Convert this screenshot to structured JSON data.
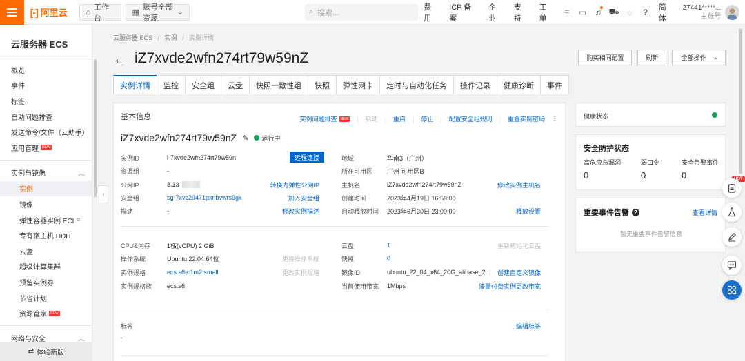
{
  "topbar": {
    "logo_text": "阿里云",
    "workbench": "工作台",
    "account_scope": "账号全部资源",
    "search_placeholder": "搜索...",
    "links": [
      "费用",
      "ICP 备案",
      "企业",
      "支持",
      "工单"
    ],
    "lang": "简体",
    "account_name": "27441*****...",
    "account_role": "主账号"
  },
  "sidebar": {
    "title": "云服务器 ECS",
    "top_items": [
      "概览",
      "事件",
      "标签",
      "自助问题排查",
      "发送命令/文件（云助手）",
      "应用管理"
    ],
    "group1": "实例与镜像",
    "group1_items": [
      "实例",
      "镜像",
      "弹性容器实例 ECI",
      "专有宿主机 DDH",
      "云盒",
      "超级计算集群",
      "预留实例券",
      "节省计划",
      "资源管家"
    ],
    "group2": "网络与安全",
    "footer": "体验新版",
    "new_badge": "NEW"
  },
  "main": {
    "breadcrumb": [
      "云服务器 ECS",
      "实例",
      "实例详情"
    ],
    "title": "iZ7xvde2wfn274rt79w59nZ",
    "actions": [
      "购买相同配置",
      "刷新",
      "全部操作"
    ],
    "tabs": [
      "实例详情",
      "监控",
      "安全组",
      "云盘",
      "快照一致性组",
      "快照",
      "弹性网卡",
      "定时与自动化任务",
      "操作记录",
      "健康诊断",
      "事件"
    ]
  },
  "basic": {
    "heading": "基本信息",
    "quick_actions": [
      "实例问题排查",
      "启动",
      "重启",
      "停止",
      "配置安全组规则",
      "重置实例密码"
    ],
    "instance_name": "iZ7xvde2wfn274rt79w59nZ",
    "status": "运行中",
    "connect_btn": "远程连接",
    "left": [
      {
        "label": "实例ID",
        "value": "i-7xvde2wfn274rt79w59n",
        "link": ""
      },
      {
        "label": "资源组",
        "value": "-",
        "link": ""
      },
      {
        "label": "公网IP",
        "value": "8.13",
        "link": "转换为弹性公网IP"
      },
      {
        "label": "安全组",
        "value": "sg-7xvc29471pxnbvwrs9gk",
        "link": "加入安全组"
      },
      {
        "label": "描述",
        "value": "-",
        "link": "修改实例描述"
      }
    ],
    "right": [
      {
        "label": "地域",
        "value": "华南3（广州）",
        "link": ""
      },
      {
        "label": "所在可用区",
        "value": "广州 可用区B",
        "link": ""
      },
      {
        "label": "主机名",
        "value": "iZ7xvde2wfn274rt79w59nZ",
        "link": "修改实例主机名"
      },
      {
        "label": "创建时间",
        "value": "2023年4月19日 16:59:00",
        "link": ""
      },
      {
        "label": "自动释放时间",
        "value": "2023年6月30日 23:00:00",
        "link": "释放设置"
      }
    ],
    "left2": [
      {
        "label": "CPU&内存",
        "value": "1核(vCPU) 2 GiB",
        "link": ""
      },
      {
        "label": "操作系统",
        "value": "Ubuntu 22.04 64位",
        "link": "更换操作系统"
      },
      {
        "label": "实例规格",
        "value": "ecs.s6-c1m2.small",
        "link": "更改实例规格"
      },
      {
        "label": "实例规格族",
        "value": "ecs.s6",
        "link": ""
      }
    ],
    "right2": [
      {
        "label": "云盘",
        "value": "1",
        "link": "重新初始化云盘"
      },
      {
        "label": "快照",
        "value": "0",
        "link": ""
      },
      {
        "label": "镜像ID",
        "value": "ubuntu_22_04_x64_20G_alibase_2...",
        "link": "创建自定义镜像"
      },
      {
        "label": "当前使用带宽",
        "value": "1Mbps",
        "link": "按量付费实例更改带宽"
      }
    ],
    "tags_label": "标签",
    "tags_value": "-",
    "tags_link": "编辑标签"
  },
  "health": {
    "label": "健康状态"
  },
  "security": {
    "title": "安全防护状态",
    "cols": [
      {
        "label": "高危应急漏洞",
        "value": "0"
      },
      {
        "label": "弱口令",
        "value": "0"
      },
      {
        "label": "安全告警事件",
        "value": "0"
      }
    ]
  },
  "events": {
    "title": "重要事件告警",
    "link": "查看详情",
    "empty": "暂无重要事件告警信息"
  },
  "float": {
    "hot": "HOT"
  }
}
